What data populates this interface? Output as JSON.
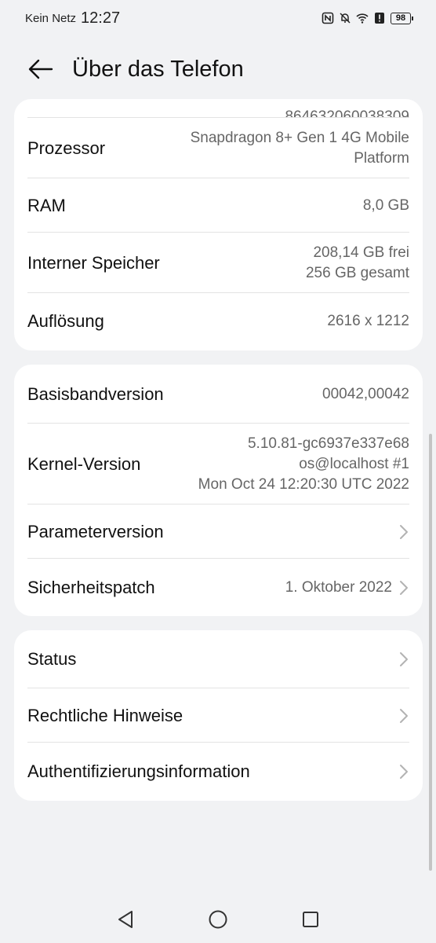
{
  "statusbar": {
    "carrier": "Kein Netz",
    "time": "12:27",
    "battery": "98"
  },
  "header": {
    "title": "Über das Telefon"
  },
  "card1": {
    "top_partial_value": "864632060038309",
    "rows": [
      {
        "label": "Prozessor",
        "value_line1": "Snapdragon 8+ Gen 1 4G Mobile",
        "value_line2": "Platform"
      },
      {
        "label": "RAM",
        "value_line1": "8,0 GB"
      },
      {
        "label": "Interner Speicher",
        "value_line1": "208,14  GB frei",
        "value_line2": "256  GB gesamt"
      },
      {
        "label": "Auflösung",
        "value_line1": "2616 x 1212"
      }
    ]
  },
  "card2": {
    "rows": [
      {
        "label": "Basisbandversion",
        "value_line1": "00042,00042"
      },
      {
        "label": "Kernel-Version",
        "value_line1": "5.10.81-gc6937e337e68",
        "value_line2": "os@localhost #1",
        "value_line3": "Mon Oct 24 12:20:30 UTC 2022"
      },
      {
        "label": "Parameterversion",
        "value_line1": ""
      },
      {
        "label": "Sicherheitspatch",
        "value_line1": "1. Oktober 2022"
      }
    ]
  },
  "card3": {
    "rows": [
      {
        "label": "Status"
      },
      {
        "label": "Rechtliche Hinweise"
      },
      {
        "label": "Authentifizierungsinformation"
      }
    ]
  }
}
